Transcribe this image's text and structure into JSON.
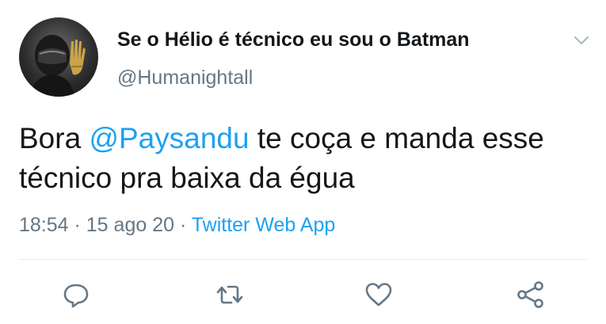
{
  "tweet": {
    "display_name": "Se o Hélio é técnico eu sou o Batman",
    "handle": "@Humanightall",
    "text_before": "Bora ",
    "mention": "@Paysandu",
    "text_after": " te coça e manda esse técnico pra baixa da égua",
    "time": "18:54",
    "date": "15 ago 20",
    "separator": " · ",
    "source": "Twitter Web App"
  },
  "icons": {
    "menu": "chevron-down-icon",
    "reply": "reply-icon",
    "retweet": "retweet-icon",
    "like": "heart-icon",
    "share": "share-icon"
  },
  "colors": {
    "text": "#14171a",
    "secondary": "#657786",
    "link": "#1da1f2",
    "divider": "#e1e8ed"
  }
}
